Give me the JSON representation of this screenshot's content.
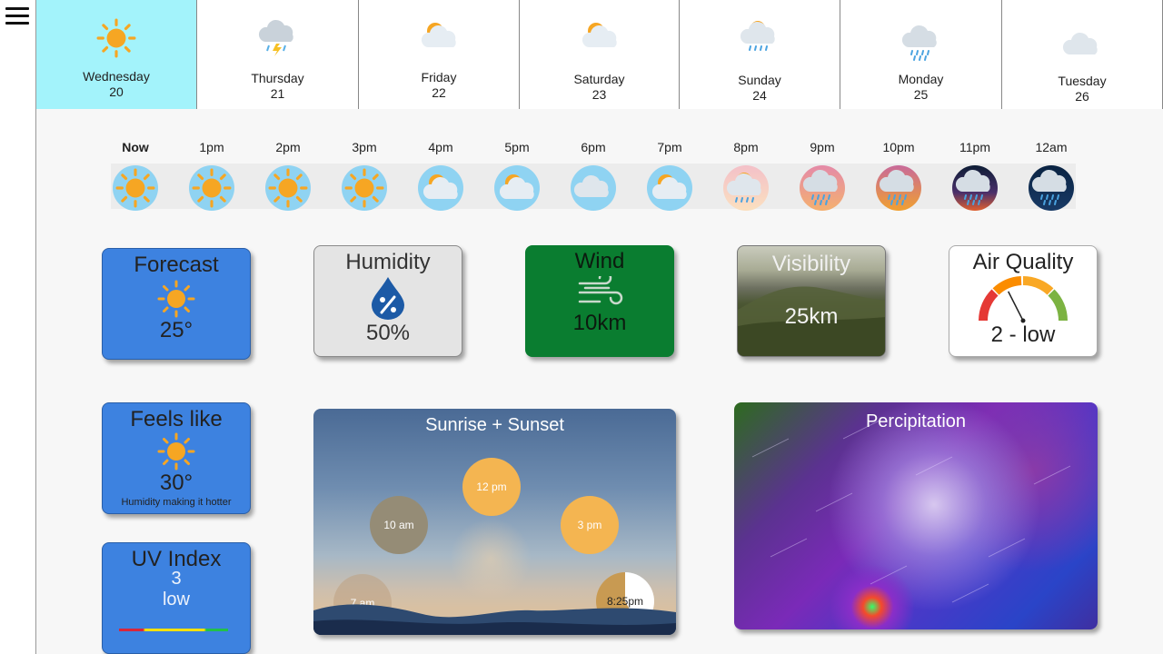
{
  "menu": {
    "icon": "hamburger-menu-icon"
  },
  "days": [
    {
      "name": "Wednesday",
      "date": "20",
      "icon": "sunny-icon",
      "active": true
    },
    {
      "name": "Thursday",
      "date": "21",
      "icon": "thunderstorm-icon",
      "active": false
    },
    {
      "name": "Friday",
      "date": "22",
      "icon": "partly-cloudy-icon",
      "active": false
    },
    {
      "name": "Saturday",
      "date": "23",
      "icon": "partly-cloudy-icon",
      "active": false
    },
    {
      "name": "Sunday",
      "date": "24",
      "icon": "sun-rain-icon",
      "active": false
    },
    {
      "name": "Monday",
      "date": "25",
      "icon": "rain-icon",
      "active": false
    },
    {
      "name": "Tuesday",
      "date": "26",
      "icon": "cloud-icon",
      "active": false
    }
  ],
  "hours": [
    {
      "label": "Now",
      "icon": "sunny-icon"
    },
    {
      "label": "1pm",
      "icon": "sunny-icon"
    },
    {
      "label": "2pm",
      "icon": "sunny-icon"
    },
    {
      "label": "3pm",
      "icon": "sunny-icon"
    },
    {
      "label": "4pm",
      "icon": "partly-cloudy-icon"
    },
    {
      "label": "5pm",
      "icon": "partly-cloudy-icon"
    },
    {
      "label": "6pm",
      "icon": "cloud-icon"
    },
    {
      "label": "7pm",
      "icon": "partly-cloudy-icon"
    },
    {
      "label": "8pm",
      "icon": "sun-rain-icon"
    },
    {
      "label": "9pm",
      "icon": "rain-icon"
    },
    {
      "label": "10pm",
      "icon": "rain-icon"
    },
    {
      "label": "11pm",
      "icon": "rain-icon"
    },
    {
      "label": "12am",
      "icon": "rain-icon"
    }
  ],
  "forecast": {
    "title": "Forecast",
    "value": "25°",
    "icon": "sunny-icon"
  },
  "humidity": {
    "title": "Humidity",
    "value": "50%",
    "icon": "humidity-drop-icon"
  },
  "wind": {
    "title": "Wind",
    "value": "10km",
    "icon": "wind-icon"
  },
  "visibility": {
    "title": "Visibility",
    "value": "25km"
  },
  "air_quality": {
    "title": "Air Quality",
    "value": "2 - low",
    "icon": "gauge-icon",
    "level": 0.35
  },
  "feels_like": {
    "title": "Feels like",
    "value": "30°",
    "note": "Humidity making it hotter",
    "icon": "sunny-icon"
  },
  "uv_index": {
    "title": "UV Index",
    "value": "3",
    "level": "low"
  },
  "sunrise_sunset": {
    "title": "Sunrise + Sunset",
    "times": [
      "7 am",
      "10 am",
      "12 pm",
      "3 pm",
      "8:25pm"
    ]
  },
  "precipitation": {
    "title": "Percipitation"
  },
  "colors": {
    "active_day": "#a3f3fb",
    "card_blue": "#3d82e0",
    "wind_green": "#0a7d30",
    "sun": "#f6a623",
    "sky": "#8fd3f2"
  }
}
